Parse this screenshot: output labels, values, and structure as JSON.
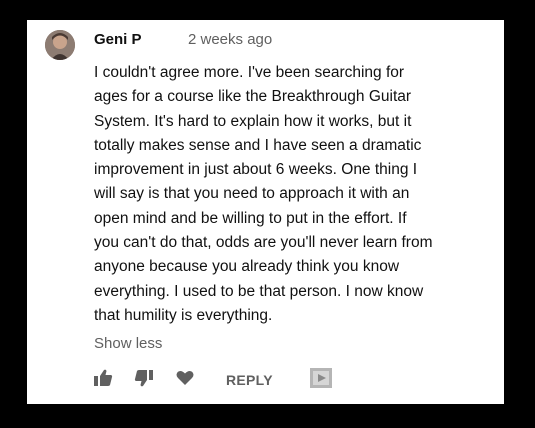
{
  "comment": {
    "author": "Geni P",
    "timestamp": "2 weeks ago",
    "text": "I couldn't agree more.  I've been searching for\nages for a course like the Breakthrough Guitar\nSystem.  It's hard to explain how it works, but it\ntotally makes sense and I have seen a dramatic\nimprovement in just about 6 weeks.  One thing I\nwill say is that you need to approach it with an\nopen mind and be willing to put in the effort.  If\nyou can't do that, odds are you'll never learn from\nanyone because you already think you know\neverything.  I used to be that person.  I now know\nthat humility is everything.",
    "show_less_label": "Show less"
  },
  "actions": {
    "reply_label": "REPLY",
    "icons": [
      "thumbs-up-icon",
      "thumbs-down-icon",
      "heart-icon",
      "creator-heart-icon"
    ]
  },
  "colors": {
    "background": "#000000",
    "card": "#ffffff",
    "text": "#111111",
    "secondary": "#606060"
  }
}
